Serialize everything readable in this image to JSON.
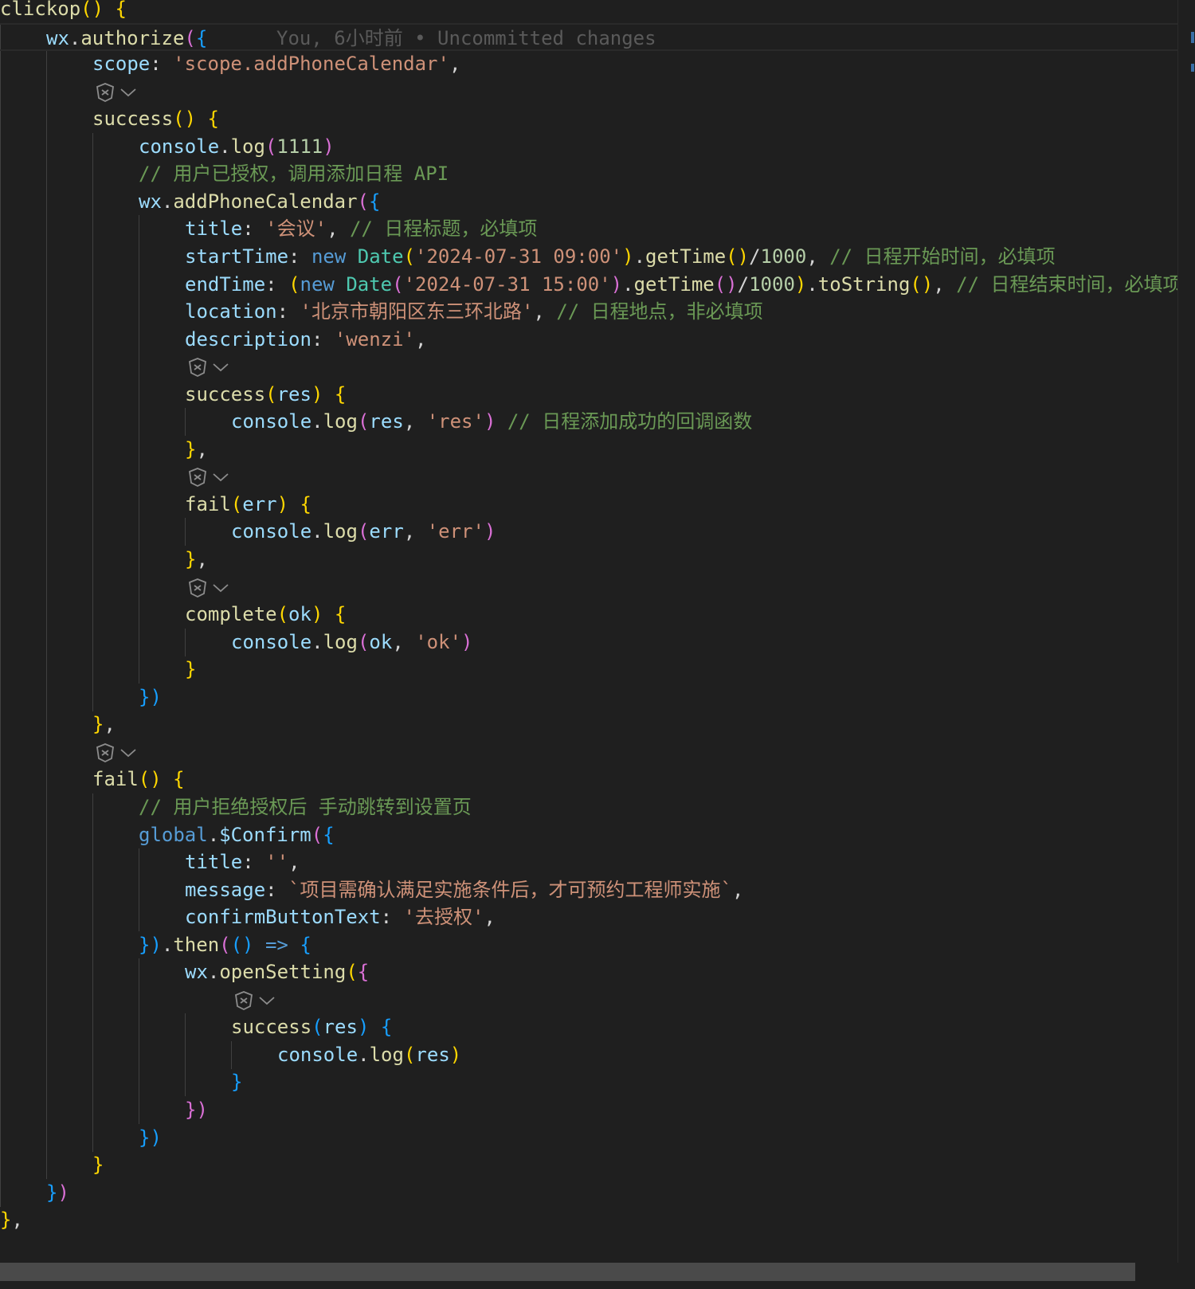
{
  "editor": {
    "blame": "You, 6小时前 • Uncommitted changes",
    "lines": [
      {
        "indent": 0,
        "tokens": [
          {
            "t": "clickop",
            "c": "fn"
          },
          {
            "t": "()",
            "c": "b1"
          },
          {
            "t": " ",
            "c": "p"
          },
          {
            "t": "{",
            "c": "b1"
          }
        ]
      },
      {
        "indent": 1,
        "tokens": [
          {
            "t": "wx",
            "c": "prop"
          },
          {
            "t": ".",
            "c": "p"
          },
          {
            "t": "authorize",
            "c": "fn"
          },
          {
            "t": "(",
            "c": "b2"
          },
          {
            "t": "{",
            "c": "b3"
          }
        ],
        "current": true
      },
      {
        "indent": 2,
        "tokens": [
          {
            "t": "scope",
            "c": "prop"
          },
          {
            "t": ": ",
            "c": "p"
          },
          {
            "t": "'scope.addPhoneCalendar'",
            "c": "str"
          },
          {
            "t": ",",
            "c": "p"
          }
        ]
      },
      {
        "lens": 2
      },
      {
        "indent": 2,
        "tokens": [
          {
            "t": "success",
            "c": "fn"
          },
          {
            "t": "()",
            "c": "b1"
          },
          {
            "t": " ",
            "c": "p"
          },
          {
            "t": "{",
            "c": "b1"
          }
        ]
      },
      {
        "indent": 3,
        "tokens": [
          {
            "t": "console",
            "c": "prop"
          },
          {
            "t": ".",
            "c": "p"
          },
          {
            "t": "log",
            "c": "fn"
          },
          {
            "t": "(",
            "c": "b2"
          },
          {
            "t": "1111",
            "c": "num"
          },
          {
            "t": ")",
            "c": "b2"
          }
        ]
      },
      {
        "indent": 3,
        "tokens": [
          {
            "t": "// 用户已授权，调用添加日程 API",
            "c": "cm"
          }
        ]
      },
      {
        "indent": 3,
        "tokens": [
          {
            "t": "wx",
            "c": "prop"
          },
          {
            "t": ".",
            "c": "p"
          },
          {
            "t": "addPhoneCalendar",
            "c": "fn"
          },
          {
            "t": "(",
            "c": "b2"
          },
          {
            "t": "{",
            "c": "b3"
          }
        ]
      },
      {
        "indent": 4,
        "tokens": [
          {
            "t": "title",
            "c": "prop"
          },
          {
            "t": ": ",
            "c": "p"
          },
          {
            "t": "'会议'",
            "c": "str"
          },
          {
            "t": ", ",
            "c": "p"
          },
          {
            "t": "// 日程标题，必填项",
            "c": "cm"
          }
        ]
      },
      {
        "indent": 4,
        "tokens": [
          {
            "t": "startTime",
            "c": "prop"
          },
          {
            "t": ": ",
            "c": "p"
          },
          {
            "t": "new",
            "c": "kw"
          },
          {
            "t": " ",
            "c": "p"
          },
          {
            "t": "Date",
            "c": "cls"
          },
          {
            "t": "(",
            "c": "b1"
          },
          {
            "t": "'2024-07-31 09:00'",
            "c": "str"
          },
          {
            "t": ")",
            "c": "b1"
          },
          {
            "t": ".",
            "c": "p"
          },
          {
            "t": "getTime",
            "c": "fn"
          },
          {
            "t": "()",
            "c": "b1"
          },
          {
            "t": "/",
            "c": "p"
          },
          {
            "t": "1000",
            "c": "num"
          },
          {
            "t": ", ",
            "c": "p"
          },
          {
            "t": "// 日程开始时间，必填项",
            "c": "cm"
          }
        ]
      },
      {
        "indent": 4,
        "tokens": [
          {
            "t": "endTime",
            "c": "prop"
          },
          {
            "t": ": ",
            "c": "p"
          },
          {
            "t": "(",
            "c": "b1"
          },
          {
            "t": "new",
            "c": "kw"
          },
          {
            "t": " ",
            "c": "p"
          },
          {
            "t": "Date",
            "c": "cls"
          },
          {
            "t": "(",
            "c": "b2"
          },
          {
            "t": "'2024-07-31 15:00'",
            "c": "str"
          },
          {
            "t": ")",
            "c": "b2"
          },
          {
            "t": ".",
            "c": "p"
          },
          {
            "t": "getTime",
            "c": "fn"
          },
          {
            "t": "()",
            "c": "b2"
          },
          {
            "t": "/",
            "c": "p"
          },
          {
            "t": "1000",
            "c": "num"
          },
          {
            "t": ")",
            "c": "b1"
          },
          {
            "t": ".",
            "c": "p"
          },
          {
            "t": "toString",
            "c": "fn"
          },
          {
            "t": "()",
            "c": "b1"
          },
          {
            "t": ", ",
            "c": "p"
          },
          {
            "t": "// 日程结束时间，必填项",
            "c": "cm"
          }
        ]
      },
      {
        "indent": 4,
        "tokens": [
          {
            "t": "location",
            "c": "prop"
          },
          {
            "t": ": ",
            "c": "p"
          },
          {
            "t": "'北京市朝阳区东三环北路'",
            "c": "str"
          },
          {
            "t": ", ",
            "c": "p"
          },
          {
            "t": "// 日程地点，非必填项",
            "c": "cm"
          }
        ]
      },
      {
        "indent": 4,
        "tokens": [
          {
            "t": "description",
            "c": "prop"
          },
          {
            "t": ": ",
            "c": "p"
          },
          {
            "t": "'wenzi'",
            "c": "str"
          },
          {
            "t": ",",
            "c": "p"
          }
        ]
      },
      {
        "lens": 4
      },
      {
        "indent": 4,
        "tokens": [
          {
            "t": "success",
            "c": "fn"
          },
          {
            "t": "(",
            "c": "b1"
          },
          {
            "t": "res",
            "c": "prop"
          },
          {
            "t": ")",
            "c": "b1"
          },
          {
            "t": " ",
            "c": "p"
          },
          {
            "t": "{",
            "c": "b1"
          }
        ]
      },
      {
        "indent": 5,
        "tokens": [
          {
            "t": "console",
            "c": "prop"
          },
          {
            "t": ".",
            "c": "p"
          },
          {
            "t": "log",
            "c": "fn"
          },
          {
            "t": "(",
            "c": "b2"
          },
          {
            "t": "res",
            "c": "prop"
          },
          {
            "t": ", ",
            "c": "p"
          },
          {
            "t": "'res'",
            "c": "str"
          },
          {
            "t": ")",
            "c": "b2"
          },
          {
            "t": " ",
            "c": "p"
          },
          {
            "t": "// 日程添加成功的回调函数",
            "c": "cm"
          }
        ]
      },
      {
        "indent": 4,
        "tokens": [
          {
            "t": "}",
            "c": "b1"
          },
          {
            "t": ",",
            "c": "p"
          }
        ]
      },
      {
        "lens": 4
      },
      {
        "indent": 4,
        "tokens": [
          {
            "t": "fail",
            "c": "fn"
          },
          {
            "t": "(",
            "c": "b1"
          },
          {
            "t": "err",
            "c": "prop"
          },
          {
            "t": ")",
            "c": "b1"
          },
          {
            "t": " ",
            "c": "p"
          },
          {
            "t": "{",
            "c": "b1"
          }
        ]
      },
      {
        "indent": 5,
        "tokens": [
          {
            "t": "console",
            "c": "prop"
          },
          {
            "t": ".",
            "c": "p"
          },
          {
            "t": "log",
            "c": "fn"
          },
          {
            "t": "(",
            "c": "b2"
          },
          {
            "t": "err",
            "c": "prop"
          },
          {
            "t": ", ",
            "c": "p"
          },
          {
            "t": "'err'",
            "c": "str"
          },
          {
            "t": ")",
            "c": "b2"
          }
        ]
      },
      {
        "indent": 4,
        "tokens": [
          {
            "t": "}",
            "c": "b1"
          },
          {
            "t": ",",
            "c": "p"
          }
        ]
      },
      {
        "lens": 4
      },
      {
        "indent": 4,
        "tokens": [
          {
            "t": "complete",
            "c": "fn"
          },
          {
            "t": "(",
            "c": "b1"
          },
          {
            "t": "ok",
            "c": "prop"
          },
          {
            "t": ")",
            "c": "b1"
          },
          {
            "t": " ",
            "c": "p"
          },
          {
            "t": "{",
            "c": "b1"
          }
        ]
      },
      {
        "indent": 5,
        "tokens": [
          {
            "t": "console",
            "c": "prop"
          },
          {
            "t": ".",
            "c": "p"
          },
          {
            "t": "log",
            "c": "fn"
          },
          {
            "t": "(",
            "c": "b2"
          },
          {
            "t": "ok",
            "c": "prop"
          },
          {
            "t": ", ",
            "c": "p"
          },
          {
            "t": "'ok'",
            "c": "str"
          },
          {
            "t": ")",
            "c": "b2"
          }
        ]
      },
      {
        "indent": 4,
        "tokens": [
          {
            "t": "}",
            "c": "b1"
          }
        ]
      },
      {
        "indent": 3,
        "tokens": [
          {
            "t": "})",
            "c": "b3"
          }
        ]
      },
      {
        "indent": 2,
        "tokens": [
          {
            "t": "}",
            "c": "b1"
          },
          {
            "t": ",",
            "c": "p"
          }
        ]
      },
      {
        "lens": 2
      },
      {
        "indent": 2,
        "tokens": [
          {
            "t": "fail",
            "c": "fn"
          },
          {
            "t": "()",
            "c": "b1"
          },
          {
            "t": " ",
            "c": "p"
          },
          {
            "t": "{",
            "c": "b1"
          }
        ]
      },
      {
        "indent": 3,
        "tokens": [
          {
            "t": "// 用户拒绝授权后 手动跳转到设置页",
            "c": "cm"
          }
        ]
      },
      {
        "indent": 3,
        "tokens": [
          {
            "t": "global",
            "c": "kw"
          },
          {
            "t": ".",
            "c": "p"
          },
          {
            "t": "$Confirm",
            "c": "prop"
          },
          {
            "t": "(",
            "c": "b2"
          },
          {
            "t": "{",
            "c": "b3"
          }
        ]
      },
      {
        "indent": 4,
        "tokens": [
          {
            "t": "title",
            "c": "prop"
          },
          {
            "t": ": ",
            "c": "p"
          },
          {
            "t": "''",
            "c": "str"
          },
          {
            "t": ",",
            "c": "p"
          }
        ]
      },
      {
        "indent": 4,
        "tokens": [
          {
            "t": "message",
            "c": "prop"
          },
          {
            "t": ": ",
            "c": "p"
          },
          {
            "t": "`项目需确认满足实施条件后，才可预约工程师实施`",
            "c": "str"
          },
          {
            "t": ",",
            "c": "p"
          }
        ]
      },
      {
        "indent": 4,
        "tokens": [
          {
            "t": "confirmButtonText",
            "c": "prop"
          },
          {
            "t": ": ",
            "c": "p"
          },
          {
            "t": "'去授权'",
            "c": "str"
          },
          {
            "t": ",",
            "c": "p"
          }
        ]
      },
      {
        "indent": 3,
        "tokens": [
          {
            "t": "})",
            "c": "b3"
          },
          {
            "t": ".",
            "c": "p"
          },
          {
            "t": "then",
            "c": "fn"
          },
          {
            "t": "(",
            "c": "b2"
          },
          {
            "t": "()",
            "c": "b3"
          },
          {
            "t": " ",
            "c": "p"
          },
          {
            "t": "=>",
            "c": "kw"
          },
          {
            "t": " ",
            "c": "p"
          },
          {
            "t": "{",
            "c": "b3"
          }
        ]
      },
      {
        "indent": 4,
        "tokens": [
          {
            "t": "wx",
            "c": "prop"
          },
          {
            "t": ".",
            "c": "p"
          },
          {
            "t": "openSetting",
            "c": "fn"
          },
          {
            "t": "(",
            "c": "b1"
          },
          {
            "t": "{",
            "c": "b2"
          }
        ]
      },
      {
        "lens": 5
      },
      {
        "indent": 5,
        "tokens": [
          {
            "t": "success",
            "c": "fn"
          },
          {
            "t": "(",
            "c": "b3"
          },
          {
            "t": "res",
            "c": "prop"
          },
          {
            "t": ")",
            "c": "b3"
          },
          {
            "t": " ",
            "c": "p"
          },
          {
            "t": "{",
            "c": "b3"
          }
        ]
      },
      {
        "indent": 6,
        "tokens": [
          {
            "t": "console",
            "c": "prop"
          },
          {
            "t": ".",
            "c": "p"
          },
          {
            "t": "log",
            "c": "fn"
          },
          {
            "t": "(",
            "c": "b1"
          },
          {
            "t": "res",
            "c": "prop"
          },
          {
            "t": ")",
            "c": "b1"
          }
        ]
      },
      {
        "indent": 5,
        "tokens": [
          {
            "t": "}",
            "c": "b3"
          }
        ]
      },
      {
        "indent": 4,
        "tokens": [
          {
            "t": "})",
            "c": "b2"
          }
        ]
      },
      {
        "indent": 3,
        "tokens": [
          {
            "t": "})",
            "c": "b3"
          }
        ]
      },
      {
        "indent": 2,
        "tokens": [
          {
            "t": "}",
            "c": "b1"
          }
        ]
      },
      {
        "indent": 1,
        "tokens": [
          {
            "t": "}",
            "c": "b3"
          },
          {
            "t": ")",
            "c": "b2"
          }
        ]
      },
      {
        "indent": 0,
        "tokens": [
          {
            "t": "}",
            "c": "b1"
          },
          {
            "t": ",",
            "c": "p"
          }
        ]
      }
    ]
  }
}
